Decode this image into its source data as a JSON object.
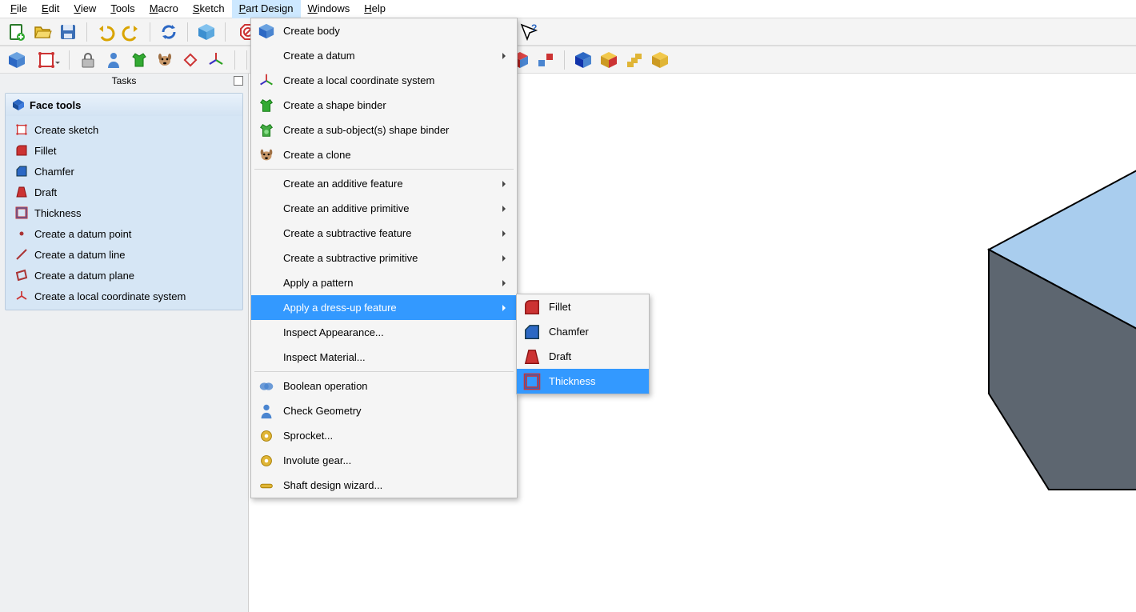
{
  "menubar": [
    "File",
    "Edit",
    "View",
    "Tools",
    "Macro",
    "Sketch",
    "Part Design",
    "Windows",
    "Help"
  ],
  "menubar_active_index": 6,
  "tasks_panel": {
    "title": "Tasks",
    "header": "Face tools",
    "items": [
      "Create sketch",
      "Fillet",
      "Chamfer",
      "Draft",
      "Thickness",
      "Create a datum point",
      "Create a datum line",
      "Create a datum plane",
      "Create a local coordinate system"
    ]
  },
  "main_menu": [
    {
      "label": "Create body"
    },
    {
      "label": "Create a datum",
      "sub": true
    },
    {
      "label": "Create a local coordinate system"
    },
    {
      "label": "Create a shape binder"
    },
    {
      "label": "Create a sub-object(s) shape binder"
    },
    {
      "label": "Create a clone"
    },
    {
      "sep": true
    },
    {
      "label": "Create an additive feature",
      "sub": true,
      "noicon": true
    },
    {
      "label": "Create an additive primitive",
      "sub": true,
      "noicon": true
    },
    {
      "label": "Create a subtractive feature",
      "sub": true,
      "noicon": true
    },
    {
      "label": "Create a subtractive primitive",
      "sub": true,
      "noicon": true
    },
    {
      "label": "Apply a pattern",
      "sub": true,
      "noicon": true
    },
    {
      "label": "Apply a dress-up feature",
      "sub": true,
      "noicon": true,
      "hov": true
    },
    {
      "label": "Inspect Appearance...",
      "noicon": true
    },
    {
      "label": "Inspect Material...",
      "noicon": true
    },
    {
      "sep": true
    },
    {
      "label": "Boolean operation"
    },
    {
      "label": "Check Geometry"
    },
    {
      "label": "Sprocket..."
    },
    {
      "label": "Involute gear..."
    },
    {
      "label": "Shaft design wizard..."
    }
  ],
  "sub_menu": [
    {
      "label": "Fillet",
      "ico": "fillet"
    },
    {
      "label": "Chamfer",
      "ico": "chamfer"
    },
    {
      "label": "Draft",
      "ico": "draft"
    },
    {
      "label": "Thickness",
      "ico": "thickness",
      "hov": true
    }
  ],
  "toolbar1_icons": [
    "new",
    "open",
    "save",
    "sep",
    "undo",
    "redo",
    "sep",
    "refresh",
    "sep",
    "box",
    "sep",
    "stop",
    "dd",
    "cube",
    "dd",
    "zoom",
    "dd",
    "sep",
    "caliper",
    "sep",
    "part",
    "folder",
    "export",
    "dd",
    "sep",
    "braces",
    "sep",
    "whatsthis"
  ],
  "toolbar2_icons": [
    "body",
    "sketch",
    "dd",
    "sep",
    "lock",
    "man",
    "shirt",
    "dog",
    "diamond",
    "axes",
    "sep",
    "sep",
    "hole",
    "rib",
    "wedge",
    "rib2",
    "screw",
    "slot",
    "sep",
    "sphere",
    "sep",
    "mirror",
    "linear",
    "polar",
    "scale",
    "sep",
    "tray",
    "block",
    "stack",
    "grid"
  ],
  "panel_icons": [
    "sketch",
    "fillet",
    "chamfer",
    "draft",
    "thick",
    "pt",
    "ln",
    "pl",
    "cs"
  ],
  "main_menu_icons": [
    "body",
    "",
    "axes",
    "shirt",
    "shirt2",
    "dog",
    "",
    "",
    "",
    "",
    "",
    "",
    "",
    "",
    "",
    "",
    "bool",
    "man",
    "gear",
    "gear",
    "rod"
  ]
}
